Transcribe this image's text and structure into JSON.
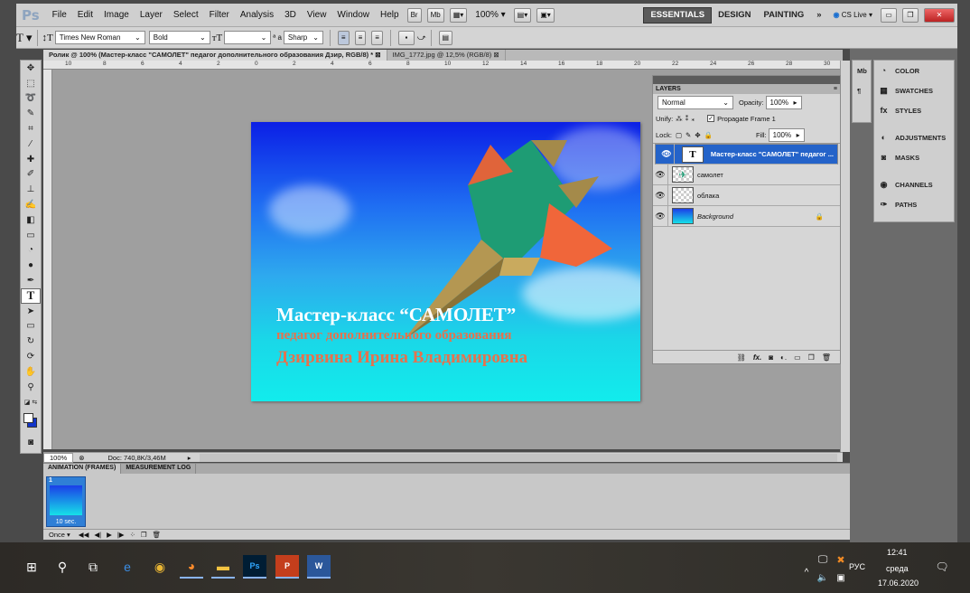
{
  "app": {
    "logo": "Ps"
  },
  "menu": [
    "File",
    "Edit",
    "Image",
    "Layer",
    "Select",
    "Filter",
    "Analysis",
    "3D",
    "View",
    "Window",
    "Help"
  ],
  "appbar": {
    "zoom": "100%",
    "workspaces": [
      "ESSENTIALS",
      "DESIGN",
      "PAINTING"
    ],
    "workspace_more": "»",
    "cslive": "CS Live"
  },
  "options": {
    "tool_glyph": "T",
    "font_family": "Times New Roman",
    "font_style": "Bold",
    "font_size": "",
    "aa_label": "ª a",
    "antialias": "Sharp"
  },
  "doc_tabs": [
    {
      "title": "Ролик @ 100% (Мастер-класс \"САМОЛЕТ\" педагог дополнительного образования Дзир, RGB/8) *",
      "active": true
    },
    {
      "title": "IMG_1772.jpg @ 12,5% (RGB/8)",
      "active": false
    }
  ],
  "ruler_ticks": [
    "10",
    "8",
    "6",
    "4",
    "2",
    "0",
    "2",
    "4",
    "6",
    "8",
    "10",
    "12",
    "14",
    "16",
    "18",
    "20",
    "22",
    "24",
    "26",
    "28",
    "30"
  ],
  "canvas_text": {
    "line1": "Мастер-класс “САМОЛЕТ”",
    "line2": "педагог дополнительного образования",
    "line3": "Дзирвина Ирина Владимировна"
  },
  "status": {
    "zoom": "100%",
    "doc": "Doc: 740,8K/3,46M"
  },
  "animation": {
    "tabs": [
      "ANIMATION (FRAMES)",
      "MEASUREMENT LOG"
    ],
    "frame_number": "1",
    "frame_delay": "10 sec.",
    "loop": "Once"
  },
  "layers_panel": {
    "tab": "LAYERS",
    "blend_mode": "Normal",
    "opacity_label": "Opacity:",
    "opacity": "100%",
    "unify_label": "Unify:",
    "propagate_label": "Propagate Frame 1",
    "lock_label": "Lock:",
    "fill_label": "Fill:",
    "fill": "100%",
    "layers": [
      {
        "name": "Мастер-класс \"САМОЛЕТ\" педагог ...",
        "thumb": "T",
        "selected": true
      },
      {
        "name": "самолет",
        "thumb": "",
        "selected": false
      },
      {
        "name": "облака",
        "thumb": "",
        "selected": false
      },
      {
        "name": "Background",
        "thumb": "",
        "selected": false
      }
    ],
    "footer_icons": [
      "link-icon",
      "fx-icon",
      "mask-icon",
      "adjustment-icon",
      "group-icon",
      "new-layer-icon",
      "trash-icon"
    ]
  },
  "side_panels": [
    "COLOR",
    "SWATCHES",
    "STYLES",
    "ADJUSTMENTS",
    "MASKS",
    "CHANNELS",
    "PATHS"
  ],
  "taskbar": {
    "lang": "РУС",
    "time": "12:41",
    "day": "среда",
    "date": "17.06.2020"
  }
}
